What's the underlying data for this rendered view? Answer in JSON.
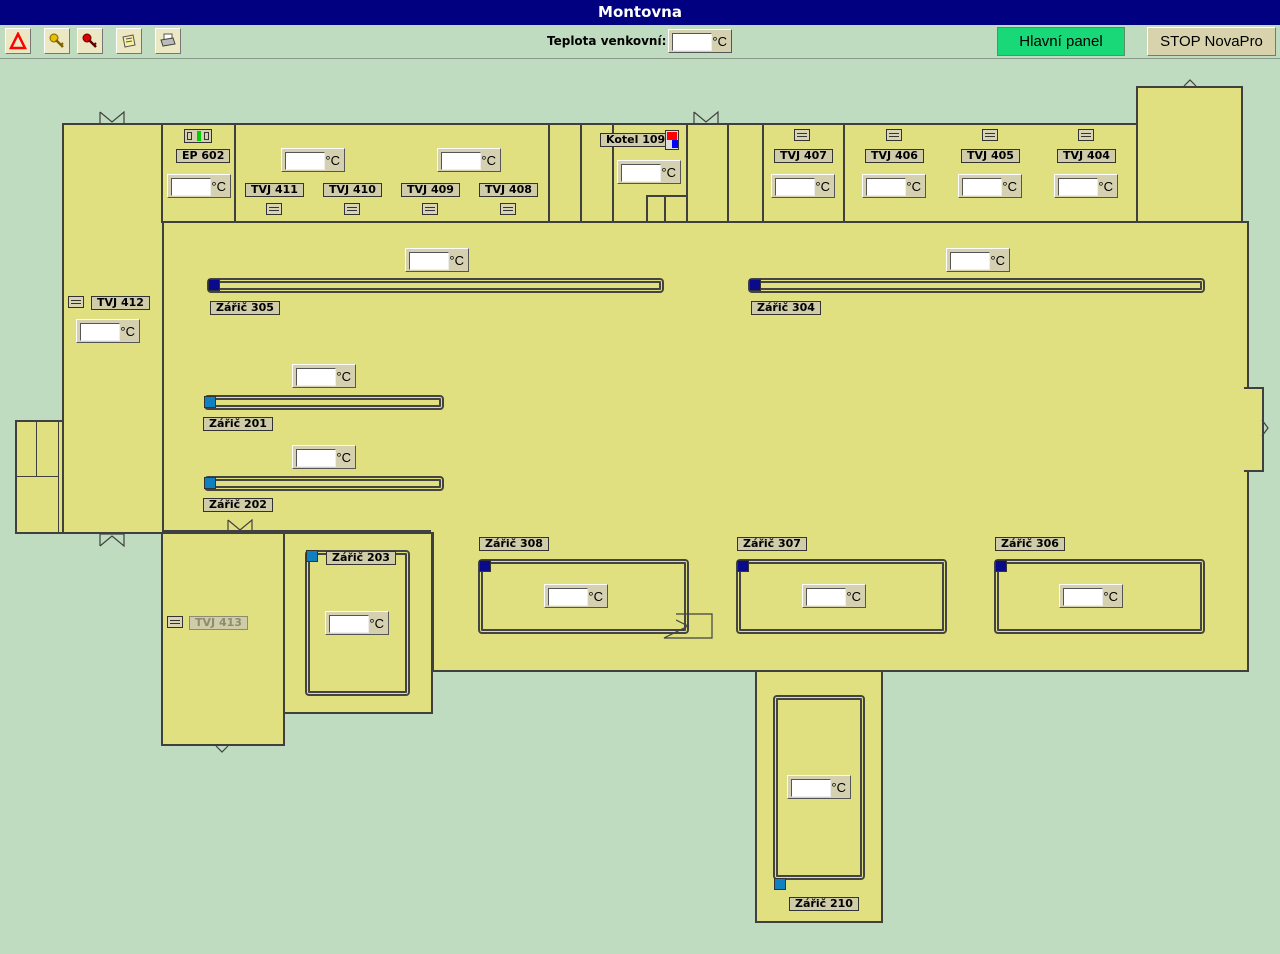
{
  "window": {
    "title": "Montovna"
  },
  "toolbar": {
    "buttons": [
      {
        "name": "alarm-button",
        "icon": "warning-triangle-icon"
      },
      {
        "name": "login-button",
        "icon": "key-yellow-icon"
      },
      {
        "name": "logout-button",
        "icon": "key-red-icon"
      },
      {
        "name": "notes-button",
        "icon": "note-icon"
      },
      {
        "name": "print-button",
        "icon": "printer-icon"
      }
    ],
    "outdoor_temp_label": "Teplota venkovní:",
    "outdoor_temp_value": "",
    "unit": "°C",
    "main_panel_label": "Hlavní panel",
    "stop_label": "STOP NovaPro"
  },
  "colors": {
    "title_bar": "#000080",
    "background": "#c0dcc0",
    "room_fill": "#e0e080",
    "main_panel_button": "#18d878",
    "heater_active": "#0a0a8c",
    "heater_idle": "#1080c0"
  },
  "units": {
    "ep602": {
      "label": "EP 602",
      "temp": ""
    },
    "kotel109": {
      "label": "Kotel 109",
      "temp": ""
    },
    "tvj411": {
      "label": "TVJ 411"
    },
    "tvj410": {
      "label": "TVJ 410"
    },
    "tvj409": {
      "label": "TVJ 409"
    },
    "tvj408": {
      "label": "TVJ 408"
    },
    "tvj407": {
      "label": "TVJ 407",
      "temp": ""
    },
    "tvj406": {
      "label": "TVJ 406",
      "temp": ""
    },
    "tvj405": {
      "label": "TVJ 405",
      "temp": ""
    },
    "tvj404": {
      "label": "TVJ 404",
      "temp": ""
    },
    "tvj412": {
      "label": "TVJ 412",
      "temp": ""
    },
    "tvj413": {
      "label": "TVJ 413"
    },
    "room_411_410_temp": "",
    "room_409_408_temp": "",
    "zaric305": {
      "label": "Zářič 305",
      "temp": ""
    },
    "zaric304": {
      "label": "Zářič 304",
      "temp": ""
    },
    "zaric201": {
      "label": "Zářič 201",
      "temp": ""
    },
    "zaric202": {
      "label": "Zářič 202",
      "temp": ""
    },
    "zaric203": {
      "label": "Zářič 203",
      "temp": ""
    },
    "zaric308": {
      "label": "Zářič 308",
      "temp": ""
    },
    "zaric307": {
      "label": "Zářič 307",
      "temp": ""
    },
    "zaric306": {
      "label": "Zářič 306",
      "temp": ""
    },
    "zaric210": {
      "label": "Zářič 210",
      "temp": ""
    }
  }
}
